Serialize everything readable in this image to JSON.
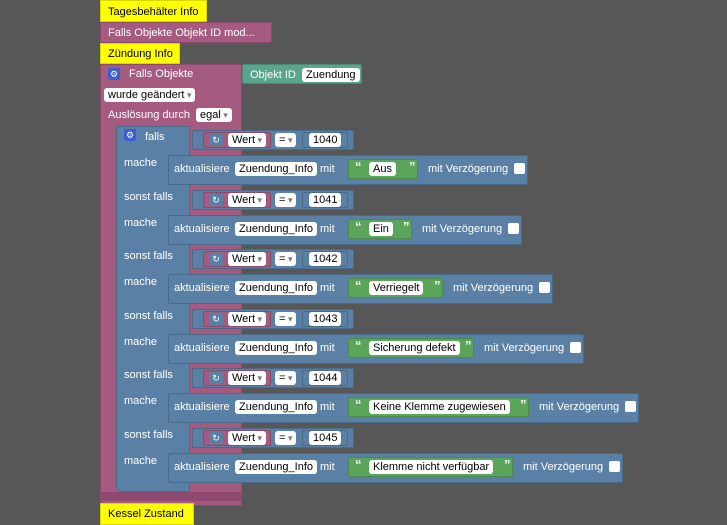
{
  "blocks": {
    "tages_title": "Tagesbehälter Info",
    "tages_collapsed": "Falls Objekte Objekt ID mod...",
    "zuendung_title": "Zündung Info",
    "falls_objekte": "Falls Objekte",
    "objekt_id_label": "Objekt ID",
    "objekt_id_value": "Zuendung",
    "wurde_geaendert": "wurde geändert",
    "ausloesung_label": "Auslösung durch",
    "ausloesung_value": "egal",
    "kessel_title": "Kessel Zustand"
  },
  "ifblock": {
    "falls": "falls",
    "mache": "mache",
    "sonst_falls": "sonst falls",
    "aktualisiere": "aktualisiere",
    "mit": "mit",
    "mit_verzoegerung": "mit Verzögerung",
    "wert": "Wert",
    "op": "=",
    "target": "Zuendung_Info"
  },
  "conditions": [
    {
      "value": "1040",
      "text": "Aus"
    },
    {
      "value": "1041",
      "text": "Ein"
    },
    {
      "value": "1042",
      "text": "Verriegelt"
    },
    {
      "value": "1043",
      "text": "Sicherung defekt"
    },
    {
      "value": "1044",
      "text": "Keine Klemme zugewiesen"
    },
    {
      "value": "1045",
      "text": "Klemme nicht verfügbar"
    }
  ],
  "colors": {
    "workspace": "#575757",
    "event_yellow": "#ffff00",
    "event_pink": "#a55b80",
    "logic_blue": "#5b80a5",
    "text_green": "#5ba55b",
    "value_teal": "#5ba58c"
  },
  "icons": [
    "gear-icon",
    "refresh-icon",
    "checkbox-icon",
    "quote-icon"
  ]
}
